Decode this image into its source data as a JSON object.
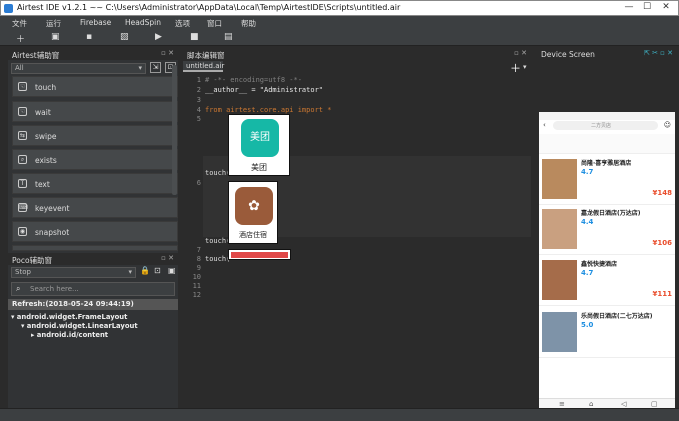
{
  "window": {
    "title": "Airtest IDE v1.2.1 ~~ C:\\Users\\Administrator\\AppData\\Local\\Temp\\AirtestIDE\\Scripts\\untitled.air"
  },
  "menu": [
    "文件",
    "运行",
    "Firebase",
    "HeadSpin",
    "选项",
    "窗口",
    "帮助"
  ],
  "left_panel": {
    "title": "Airtest辅助窗",
    "filter_value": "All",
    "actions": [
      "touch",
      "wait",
      "swipe",
      "exists",
      "text",
      "keyevent",
      "snapshot"
    ]
  },
  "poco": {
    "title": "Poco辅助窗",
    "mode_value": "Stop",
    "search_placeholder": "Search here...",
    "refresh_label": "Refresh:(2018-05-24 09:44:19)",
    "tree": [
      "android.widget.FrameLayout",
      "android.widget.LinearLayout",
      "android.id/content"
    ]
  },
  "editor": {
    "title": "脚本编辑窗",
    "tab": "untitled.air",
    "lines": [
      "1",
      "2",
      "3",
      "4",
      "5",
      "6",
      "7",
      "8",
      "9",
      "10",
      "11",
      "12"
    ],
    "code": {
      "l1": "# -*- encoding=utf8 -*-",
      "l2": "__author__ = \"Administrator\"",
      "l4": "from airtest.core.api import *",
      "touch": "touch("
    },
    "thumb1_label": "美团",
    "thumb2_label": "酒店住宿",
    "thumb1_icon": "美团"
  },
  "device": {
    "title": "Device Screen",
    "search_text": "二方贝店",
    "hotels": [
      {
        "name": "尚隆·喜亨雅居酒店",
        "score": "4.7",
        "price": "¥148"
      },
      {
        "name": "嘉龙假日酒店(万达店)",
        "score": "4.4",
        "price": "¥106"
      },
      {
        "name": "鑫悦快捷酒店",
        "score": "4.7",
        "price": "¥111"
      },
      {
        "name": "乐尚假日酒店(二七万达店)",
        "score": "5.0",
        "price": ""
      }
    ]
  }
}
